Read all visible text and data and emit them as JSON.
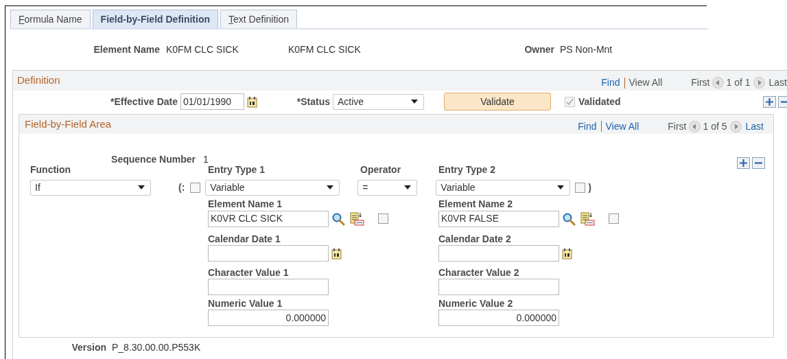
{
  "tabs": [
    {
      "label": "Formula Name",
      "selected": false,
      "mnemonic": true
    },
    {
      "label": "Field-by-Field Definition",
      "selected": true,
      "mnemonic": false
    },
    {
      "label": "Text Definition",
      "selected": false,
      "mnemonic": true
    }
  ],
  "header": {
    "element_name_label": "Element Name",
    "element_name": "K0FM CLC SICK",
    "element_description": "K0FM CLC SICK",
    "owner_label": "Owner",
    "owner": "PS Non-Mnt"
  },
  "definition": {
    "title": "Definition",
    "nav": {
      "find": {
        "label": "Find",
        "enabled": true
      },
      "view_all": {
        "label": "View All",
        "enabled": false
      },
      "first": {
        "label": "First",
        "enabled": false
      },
      "count": "1 of 1",
      "last": {
        "label": "Last",
        "enabled": false
      }
    },
    "effective_date_label": "*Effective Date",
    "effective_date": "01/01/1990",
    "status_label": "*Status",
    "status": "Active",
    "validate_button": "Validate",
    "validated": {
      "label": "Validated",
      "checked": true,
      "disabled": true
    }
  },
  "field_area": {
    "title": "Field-by-Field Area",
    "nav": {
      "find": {
        "label": "Find",
        "enabled": true
      },
      "view_all": {
        "label": "View All",
        "enabled": true
      },
      "first": {
        "label": "First",
        "enabled": false
      },
      "count": "1 of 5",
      "last": {
        "label": "Last",
        "enabled": true
      }
    },
    "sequence_label": "Sequence Number",
    "sequence": "1",
    "function": {
      "label": "Function",
      "value": "If"
    },
    "open_paren": {
      "label": "(:",
      "checked": false
    },
    "entry_type_1": {
      "label": "Entry Type 1",
      "value": "Variable"
    },
    "operator": {
      "label": "Operator",
      "value": "="
    },
    "entry_type_2": {
      "label": "Entry Type 2",
      "value": "Variable"
    },
    "close_paren": {
      "label": ")",
      "checked": false
    },
    "operands": [
      {
        "element_name_label": "Element Name 1",
        "element_name": "K0VR CLC SICK",
        "checked": false,
        "calendar_date_label": "Calendar Date 1",
        "character_value_label": "Character Value 1",
        "numeric_value_label": "Numeric Value 1",
        "numeric_value": "0.000000"
      },
      {
        "element_name_label": "Element Name 2",
        "element_name": "K0VR FALSE",
        "checked": false,
        "calendar_date_label": "Calendar Date 2",
        "character_value_label": "Character Value 2",
        "numeric_value_label": "Numeric Value 2",
        "numeric_value": "0.000000"
      }
    ]
  },
  "version": {
    "label": "Version",
    "value": "P_8.30.00.00.P553K"
  }
}
